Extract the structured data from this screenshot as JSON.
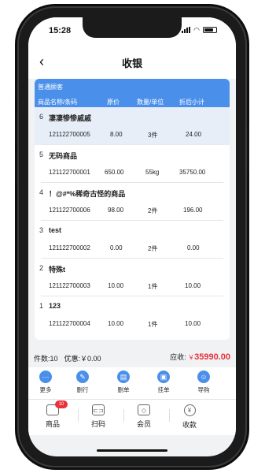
{
  "status_bar": {
    "time": "15:28"
  },
  "header": {
    "title": "收银",
    "back_icon": "chevron-left-icon"
  },
  "customer": {
    "label": "普通顾客"
  },
  "columns": {
    "name_code": "商品名称/条码",
    "price": "原价",
    "qty_unit": "数量/单位",
    "subtotal": "折后小计"
  },
  "items": [
    {
      "index": "6",
      "name": "凄凄惨惨戚戚",
      "code": "121122700005",
      "price": "8.00",
      "qty": "3件",
      "subtotal": "24.00",
      "highlighted": true
    },
    {
      "index": "5",
      "name": "无码商品",
      "code": "121122700001",
      "price": "650.00",
      "qty": "55kg",
      "subtotal": "35750.00"
    },
    {
      "index": "4",
      "name": "！@#*%稀奇古怪的商品",
      "code": "121122700006",
      "price": "98.00",
      "qty": "2件",
      "subtotal": "196.00"
    },
    {
      "index": "3",
      "name": "test",
      "code": "121122700002",
      "price": "0.00",
      "qty": "2件",
      "subtotal": "0.00"
    },
    {
      "index": "2",
      "name": "特殊t",
      "code": "121122700003",
      "price": "10.00",
      "qty": "1件",
      "subtotal": "10.00"
    },
    {
      "index": "1",
      "name": "123",
      "code": "121122700004",
      "price": "10.00",
      "qty": "1件",
      "subtotal": "10.00"
    }
  ],
  "summary": {
    "count_label": "件数:10",
    "discount_label": "优惠:￥0.00",
    "receivable_label": "应收:",
    "currency": "￥",
    "total": "35990.00"
  },
  "actions": [
    {
      "label": "更多",
      "icon": "more-icon"
    },
    {
      "label": "删行",
      "icon": "delete-row-icon"
    },
    {
      "label": "删单",
      "icon": "delete-order-icon"
    },
    {
      "label": "挂单",
      "icon": "hold-order-icon"
    },
    {
      "label": "导购",
      "icon": "guide-icon"
    }
  ],
  "tabs": [
    {
      "label": "商品",
      "icon": "bag-icon",
      "badge": "10"
    },
    {
      "label": "扫码",
      "icon": "scan-icon"
    },
    {
      "label": "会员",
      "icon": "member-icon"
    },
    {
      "label": "收款",
      "icon": "payment-icon"
    }
  ],
  "colors": {
    "accent": "#4a90ea",
    "total": "#e8313a",
    "highlight_row": "#e8eef8"
  }
}
